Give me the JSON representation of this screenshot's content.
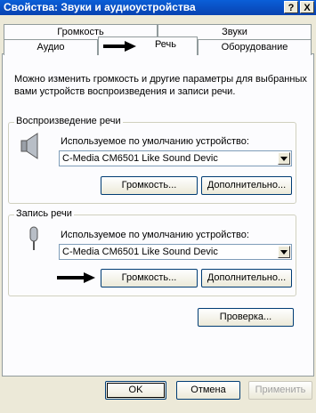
{
  "window": {
    "title": "Свойства: Звуки и аудиоустройства",
    "help_button": "?",
    "close_button": "X"
  },
  "tabs_back": [
    {
      "label": "Громкость"
    },
    {
      "label": "Звуки"
    }
  ],
  "tabs_front": [
    {
      "label": "Аудио"
    },
    {
      "label": "Речь",
      "active": true
    },
    {
      "label": "Оборудование"
    }
  ],
  "description": "Можно изменить громкость и другие параметры для выбранных вами устройств воспроизведения и записи речи.",
  "playback": {
    "title": "Воспроизведение речи",
    "device_label": "Используемое по умолчанию устройство:",
    "device_value": "C-Media CM6501 Like Sound Devic",
    "volume_button": "Громкость...",
    "advanced_button": "Дополнительно..."
  },
  "recording": {
    "title": "Запись речи",
    "device_label": "Используемое по умолчанию устройство:",
    "device_value": "C-Media CM6501 Like Sound Devic",
    "volume_button": "Громкость...",
    "advanced_button": "Дополнительно..."
  },
  "test_button": "Проверка...",
  "dialog_buttons": {
    "ok": "OK",
    "cancel": "Отмена",
    "apply": "Применить"
  }
}
